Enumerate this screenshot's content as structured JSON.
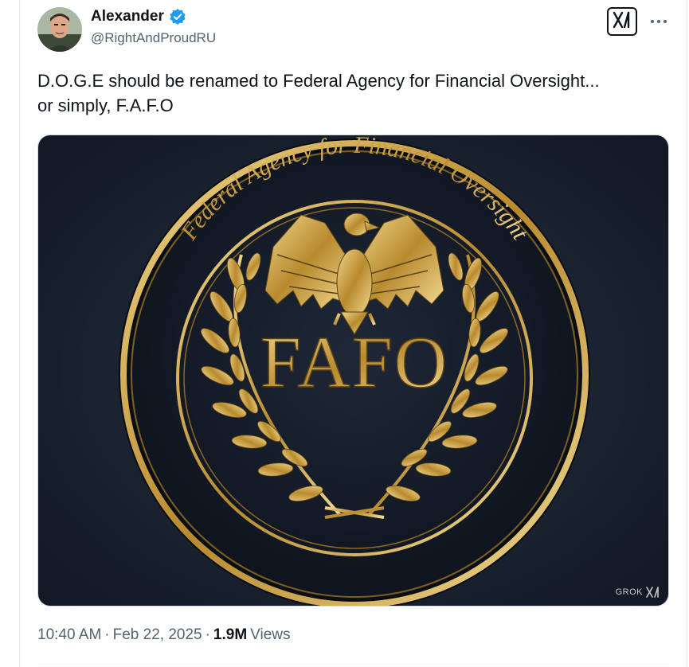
{
  "author": {
    "display_name": "Alexander",
    "handle": "@RightAndProudRU",
    "verified": true
  },
  "header_buttons": {
    "grok_icon": "grok-icon",
    "more_icon": "more-options-icon"
  },
  "tweet": {
    "text_line1": "D.O.G.E should be renamed to Federal Agency for Financial Oversight...",
    "text_line2": "or simply, F.A.F.O"
  },
  "media": {
    "ring_text": "Federal Agency for Financial Oversight",
    "center_text": "FAFO",
    "watermark": "GROK",
    "colors": {
      "background": "#1b2230",
      "gold": "#c9a24a",
      "gold_light": "#f0d68a"
    }
  },
  "meta": {
    "time": "10:40 AM",
    "separator": "·",
    "date": "Feb 22, 2025",
    "views_count": "1.9M",
    "views_label": "Views"
  },
  "colors": {
    "verified": "#1d9bf0",
    "secondary_text": "#536471",
    "primary_text": "#0f1419"
  }
}
